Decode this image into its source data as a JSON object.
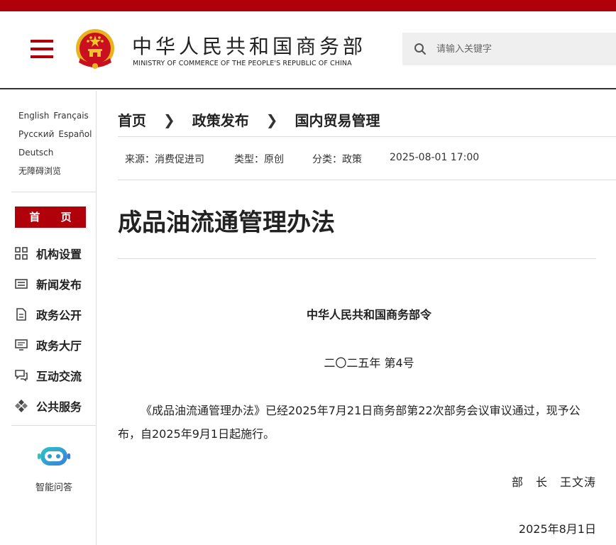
{
  "header": {
    "title_cn": "中华人民共和国商务部",
    "title_en": "MINISTRY OF COMMERCE OF THE PEOPLE'S REPUBLIC OF CHINA",
    "emblem_icon": "national-emblem-icon",
    "menu_icon": "hamburger-menu-icon",
    "brand_color": "#b0000a"
  },
  "search": {
    "placeholder": "请输入关键字",
    "icon": "search-icon"
  },
  "sidebar": {
    "languages": [
      "English",
      "Français",
      "Русский",
      "Español",
      "Deutsch"
    ],
    "accessibility": "无障碍浏览",
    "home_label": "首 页",
    "items": [
      {
        "label": "机构设置",
        "icon": "org-grid-icon"
      },
      {
        "label": "新闻发布",
        "icon": "news-icon"
      },
      {
        "label": "政务公开",
        "icon": "document-icon"
      },
      {
        "label": "政务大厅",
        "icon": "monitor-icon"
      },
      {
        "label": "互动交流",
        "icon": "chat-icon"
      },
      {
        "label": "公共服务",
        "icon": "service-icon"
      }
    ],
    "assistant_label": "智能问答",
    "assistant_icon": "robot-icon"
  },
  "breadcrumb": [
    "首页",
    "政策发布",
    "国内贸易管理"
  ],
  "meta": {
    "source": "来源：消费促进司",
    "type": "类型：原创",
    "category": "分类：政策",
    "datetime": "2025-08-01 17:00"
  },
  "article": {
    "title": "成品油流通管理办法",
    "issuer": "中华人民共和国商务部令",
    "number": "二〇二五年 第4号",
    "body": "《成品油流通管理办法》已经2025年7月21日商务部第22次部务会议审议通过，现予公布，自2025年9月1日起施行。",
    "signature": "部　长　王文涛",
    "date": "2025年8月1日"
  }
}
